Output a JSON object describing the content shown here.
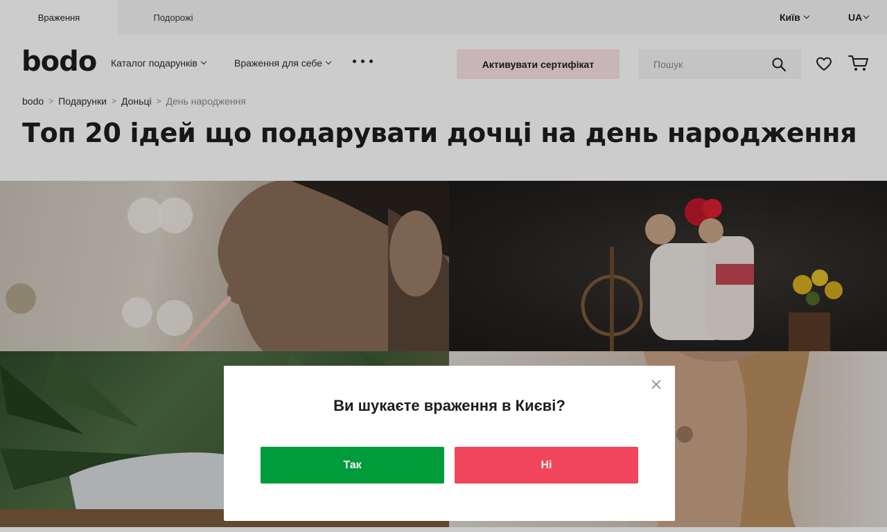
{
  "colors": {
    "accent_pink": "#fbe3e6",
    "yes_green": "#009b3a",
    "no_red": "#f0455a",
    "text_dark": "#1d1d1d",
    "muted": "#8a8a8a",
    "overlay": "rgba(0,0,0,0.2)"
  },
  "topbar": {
    "tabs": [
      {
        "label": "Враження",
        "active": true
      },
      {
        "label": "Подорожі",
        "active": false
      }
    ],
    "city": "Київ",
    "language": "UA"
  },
  "header": {
    "logo": "bodo",
    "nav": [
      {
        "label": "Каталог подарунків"
      },
      {
        "label": "Враження для себе"
      }
    ],
    "more_icon": "more-dots-icon",
    "activate_label": "Активувати сертифікат",
    "search": {
      "placeholder": "Пошук",
      "value": ""
    },
    "icons": [
      "search-icon",
      "heart-icon",
      "cart-icon"
    ]
  },
  "breadcrumb": [
    "bodo",
    "Подарунки",
    "Доньці",
    "День народження"
  ],
  "page_title": "Топ 20 ідей що подарувати дочці на день народження",
  "hero": {
    "images": [
      "woman-lipgloss-photo",
      "couple-embroidered-photo",
      "plants-relax-photo",
      "woman-tattoo-photo"
    ]
  },
  "modal": {
    "title": "Ви шукаєте враження в Києві?",
    "yes_label": "Так",
    "no_label": "Ні",
    "close_icon": "close-icon"
  }
}
